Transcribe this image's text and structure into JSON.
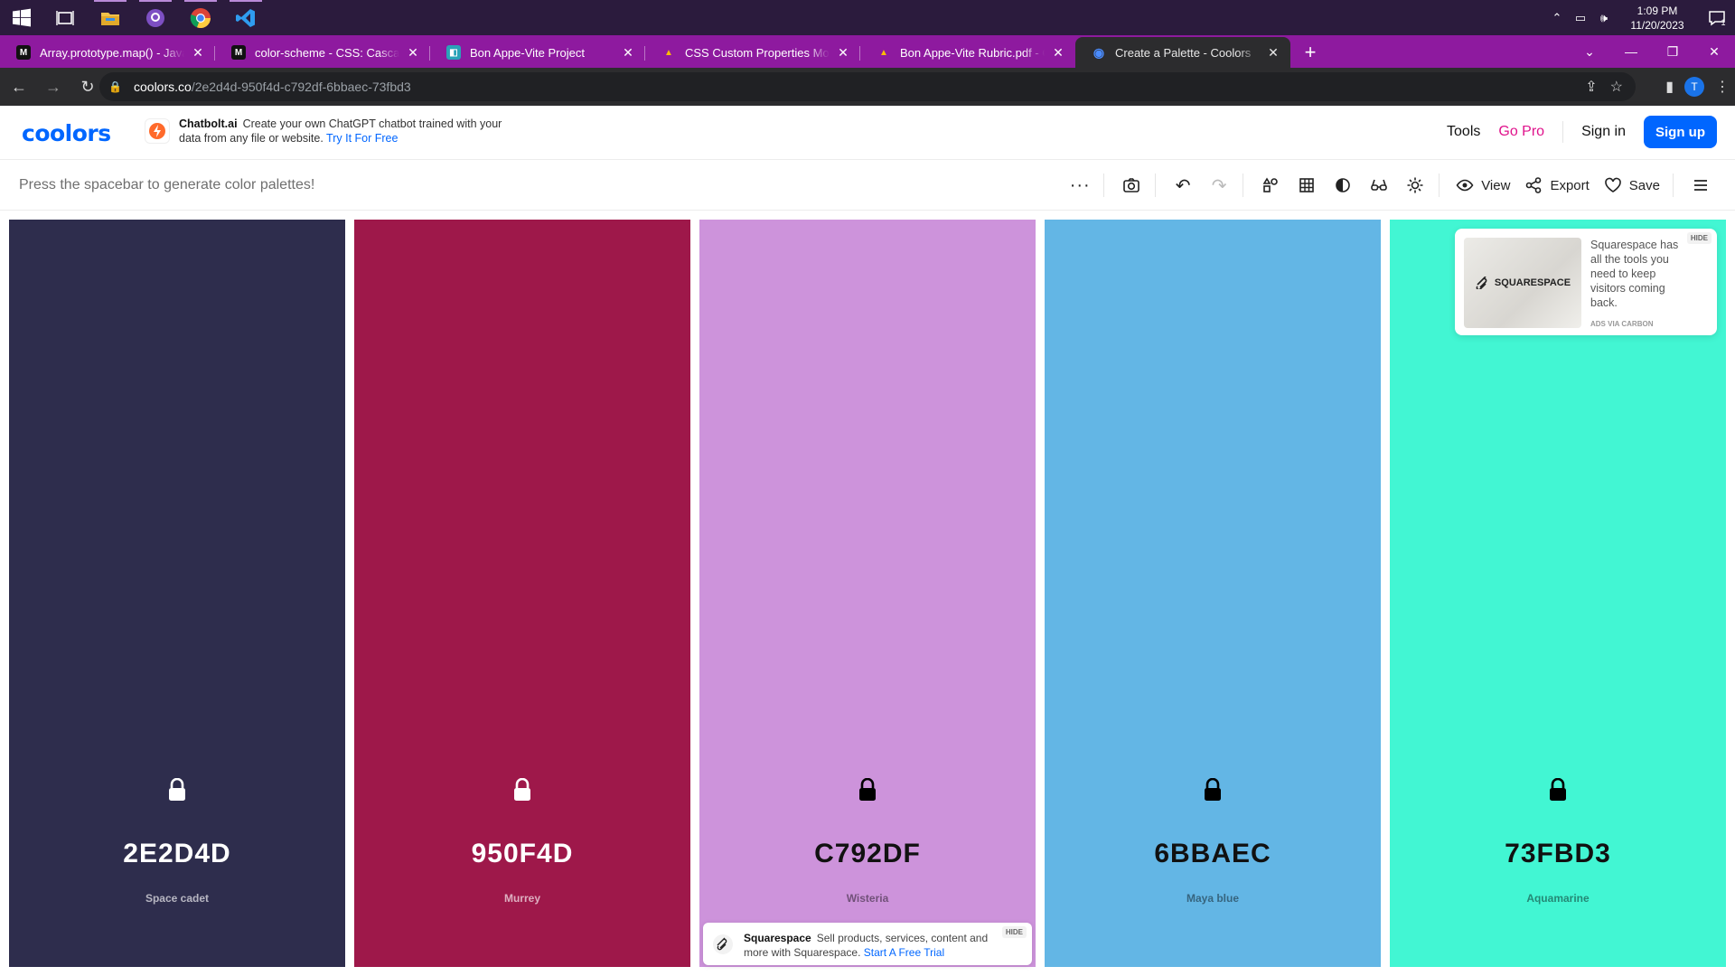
{
  "taskbar": {
    "apps": [
      "windows-start",
      "task-view",
      "file-explorer",
      "github-desktop",
      "chrome",
      "vscode"
    ],
    "clock_time": "1:09 PM",
    "clock_date": "11/20/2023",
    "notification_count": "1"
  },
  "browser": {
    "tabs": [
      {
        "title": "Array.prototype.map() - JavaScript | MDN",
        "favicon": "M"
      },
      {
        "title": "color-scheme - CSS: Cascading Style Sheets",
        "favicon": "M"
      },
      {
        "title": "Bon Appe-Vite Project",
        "favicon": "◧"
      },
      {
        "title": "CSS Custom Properties Module",
        "favicon": "▲"
      },
      {
        "title": "Bon Appe-Vite Rubric.pdf - Google Drive",
        "favicon": "▲"
      },
      {
        "title": "Create a Palette - Coolors",
        "favicon": "◉"
      }
    ],
    "url_host": "coolors.co",
    "url_path": "/2e2d4d-950f4d-c792df-6bbaec-73fbd3",
    "profile_initial": "T"
  },
  "header": {
    "logo": "coolors",
    "ad_brand": "Chatbolt.ai",
    "ad_text": "Create your own ChatGPT chatbot trained with your data from any file or website.",
    "ad_cta": "Try It For Free",
    "tools": "Tools",
    "go_pro": "Go Pro",
    "sign_in": "Sign in",
    "sign_up": "Sign up"
  },
  "toolbar": {
    "hint": "Press the spacebar to generate color palettes!",
    "view": "View",
    "export": "Export",
    "save": "Save"
  },
  "palette": [
    {
      "hex": "2E2D4D",
      "name": "Space cadet",
      "color": "#2e2d4d",
      "tone": "light"
    },
    {
      "hex": "950F4D",
      "name": "Murrey",
      "color": "#9e184a",
      "tone": "light"
    },
    {
      "hex": "C792DF",
      "name": "Wisteria",
      "color": "#cd93db",
      "tone": "dark"
    },
    {
      "hex": "6BBAEC",
      "name": "Maya blue",
      "color": "#63b6e5",
      "tone": "dark"
    },
    {
      "hex": "73FBD3",
      "name": "Aquamarine",
      "color": "#42f6d3",
      "tone": "dark"
    }
  ],
  "ad_card": {
    "image_label": "SQUARESPACE",
    "text": "Squarespace has all the tools you need to keep visitors coming back.",
    "via": "ADS VIA CARBON",
    "hide": "HIDE"
  },
  "ad_bottom": {
    "brand": "Squarespace",
    "text": "Sell products, services, content and more with Squarespace.",
    "cta": "Start A Free Trial",
    "hide": "HIDE"
  }
}
